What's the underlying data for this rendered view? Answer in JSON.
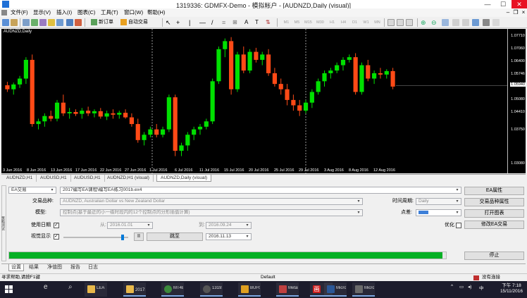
{
  "window": {
    "title": "1319336: GDMFX-Demo - 模拟帐户 - [AUDNZD,Daily (visual)]",
    "min": "—",
    "max": "☐",
    "close": "✕"
  },
  "menu": [
    "文件(F)",
    "显示(V)",
    "插入(I)",
    "图表(C)",
    "工具(T)",
    "窗口(W)",
    "帮助(H)"
  ],
  "toolbar": {
    "new_order": "新订单",
    "autotrade": "自动交易",
    "timeframes": [
      "M1",
      "M5",
      "M15",
      "M30",
      "H1",
      "H4",
      "D1",
      "W1",
      "MN"
    ],
    "font_a": "A",
    "text_t": "T"
  },
  "chart": {
    "symbol": "AUDNZD,Daily",
    "price_labels": [
      "1.07710",
      "1.07060",
      "1.06400",
      "1.05746",
      "1.05080",
      "1.04410",
      "1.03750",
      "1.03080"
    ],
    "current_price": "1.05940",
    "date_labels": [
      "3 Jun 2016",
      "8 Jun 2016",
      "13 Jun 2016",
      "17 Jun 2016",
      "22 Jun 2016",
      "27 Jun 2016",
      "1 Jul 2016",
      "6 Jul 2016",
      "11 Jul 2016",
      "15 Jul 2016",
      "20 Jul 2016",
      "25 Jul 2016",
      "29 Jul 2016",
      "3 Aug 2016",
      "8 Aug 2016",
      "12 Aug 2016"
    ],
    "colors": {
      "bull": "#00e000",
      "bear": "#ff4a16",
      "bg": "#000000"
    }
  },
  "chart_data": {
    "type": "candlestick",
    "symbol": "AUDNZD",
    "timeframe": "Daily",
    "dates": [
      "3 Jun 2016",
      "8 Jun 2016",
      "13 Jun 2016",
      "17 Jun 2016",
      "22 Jun 2016",
      "27 Jun 2016",
      "1 Jul 2016",
      "6 Jul 2016",
      "11 Jul 2016",
      "15 Jul 2016",
      "20 Jul 2016",
      "25 Jul 2016",
      "29 Jul 2016",
      "3 Aug 2016",
      "8 Aug 2016",
      "12 Aug 2016"
    ],
    "ylim": [
      1.03,
      1.079
    ],
    "candles": [
      {
        "o": 1.0595,
        "h": 1.0608,
        "l": 1.057,
        "c": 1.058
      },
      {
        "o": 1.058,
        "h": 1.0605,
        "l": 1.056,
        "c": 1.0598
      },
      {
        "o": 1.0598,
        "h": 1.063,
        "l": 1.0585,
        "c": 1.062
      },
      {
        "o": 1.062,
        "h": 1.07,
        "l": 1.06,
        "c": 1.069
      },
      {
        "o": 1.069,
        "h": 1.071,
        "l": 1.044,
        "c": 1.045
      },
      {
        "o": 1.045,
        "h": 1.047,
        "l": 1.043,
        "c": 1.046
      },
      {
        "o": 1.046,
        "h": 1.049,
        "l": 1.044,
        "c": 1.048
      },
      {
        "o": 1.048,
        "h": 1.05,
        "l": 1.046,
        "c": 1.047
      },
      {
        "o": 1.047,
        "h": 1.054,
        "l": 1.046,
        "c": 1.053
      },
      {
        "o": 1.053,
        "h": 1.056,
        "l": 1.048,
        "c": 1.049
      },
      {
        "o": 1.049,
        "h": 1.051,
        "l": 1.047,
        "c": 1.0495
      },
      {
        "o": 1.0495,
        "h": 1.0505,
        "l": 1.048,
        "c": 1.0488
      },
      {
        "o": 1.0488,
        "h": 1.051,
        "l": 1.047,
        "c": 1.05
      },
      {
        "o": 1.05,
        "h": 1.0515,
        "l": 1.048,
        "c": 1.049
      },
      {
        "o": 1.049,
        "h": 1.0505,
        "l": 1.0475,
        "c": 1.0498
      },
      {
        "o": 1.0498,
        "h": 1.051,
        "l": 1.047,
        "c": 1.0478
      },
      {
        "o": 1.0478,
        "h": 1.05,
        "l": 1.0465,
        "c": 1.049
      },
      {
        "o": 1.049,
        "h": 1.0505,
        "l": 1.047,
        "c": 1.0485
      },
      {
        "o": 1.0485,
        "h": 1.05,
        "l": 1.047,
        "c": 1.0492
      },
      {
        "o": 1.0492,
        "h": 1.0505,
        "l": 1.047,
        "c": 1.0475
      },
      {
        "o": 1.0475,
        "h": 1.049,
        "l": 1.044,
        "c": 1.045
      },
      {
        "o": 1.045,
        "h": 1.047,
        "l": 1.038,
        "c": 1.039
      },
      {
        "o": 1.039,
        "h": 1.042,
        "l": 1.037,
        "c": 1.041
      },
      {
        "o": 1.041,
        "h": 1.044,
        "l": 1.04,
        "c": 1.043
      },
      {
        "o": 1.043,
        "h": 1.045,
        "l": 1.04,
        "c": 1.041
      },
      {
        "o": 1.041,
        "h": 1.044,
        "l": 1.04,
        "c": 1.043
      },
      {
        "o": 1.043,
        "h": 1.056,
        "l": 1.042,
        "c": 1.055
      },
      {
        "o": 1.055,
        "h": 1.056,
        "l": 1.033,
        "c": 1.035
      },
      {
        "o": 1.035,
        "h": 1.038,
        "l": 1.033,
        "c": 1.037
      },
      {
        "o": 1.037,
        "h": 1.042,
        "l": 1.035,
        "c": 1.041
      },
      {
        "o": 1.041,
        "h": 1.044,
        "l": 1.039,
        "c": 1.043
      },
      {
        "o": 1.043,
        "h": 1.045,
        "l": 1.041,
        "c": 1.044
      },
      {
        "o": 1.044,
        "h": 1.047,
        "l": 1.043,
        "c": 1.046
      },
      {
        "o": 1.046,
        "h": 1.062,
        "l": 1.045,
        "c": 1.061
      },
      {
        "o": 1.061,
        "h": 1.074,
        "l": 1.06,
        "c": 1.073
      },
      {
        "o": 1.073,
        "h": 1.077,
        "l": 1.07,
        "c": 1.076
      },
      {
        "o": 1.076,
        "h": 1.0775,
        "l": 1.056,
        "c": 1.058
      },
      {
        "o": 1.058,
        "h": 1.072,
        "l": 1.057,
        "c": 1.071
      },
      {
        "o": 1.071,
        "h": 1.074,
        "l": 1.064,
        "c": 1.065
      },
      {
        "o": 1.065,
        "h": 1.073,
        "l": 1.064,
        "c": 1.072
      },
      {
        "o": 1.072,
        "h": 1.0735,
        "l": 1.068,
        "c": 1.069
      },
      {
        "o": 1.069,
        "h": 1.072,
        "l": 1.067,
        "c": 1.071
      },
      {
        "o": 1.071,
        "h": 1.073,
        "l": 1.063,
        "c": 1.064
      },
      {
        "o": 1.064,
        "h": 1.066,
        "l": 1.059,
        "c": 1.06
      },
      {
        "o": 1.06,
        "h": 1.062,
        "l": 1.056,
        "c": 1.058
      },
      {
        "o": 1.058,
        "h": 1.06,
        "l": 1.052,
        "c": 1.054
      },
      {
        "o": 1.054,
        "h": 1.056,
        "l": 1.05,
        "c": 1.052
      },
      {
        "o": 1.052,
        "h": 1.054,
        "l": 1.048,
        "c": 1.05
      },
      {
        "o": 1.05,
        "h": 1.054,
        "l": 1.049,
        "c": 1.053
      },
      {
        "o": 1.053,
        "h": 1.058,
        "l": 1.051,
        "c": 1.057
      },
      {
        "o": 1.057,
        "h": 1.062,
        "l": 1.056,
        "c": 1.061
      },
      {
        "o": 1.061,
        "h": 1.065,
        "l": 1.059,
        "c": 1.064
      },
      {
        "o": 1.064,
        "h": 1.066,
        "l": 1.062,
        "c": 1.065
      },
      {
        "o": 1.065,
        "h": 1.068,
        "l": 1.064,
        "c": 1.067
      },
      {
        "o": 1.067,
        "h": 1.07,
        "l": 1.065,
        "c": 1.069
      },
      {
        "o": 1.069,
        "h": 1.071,
        "l": 1.068,
        "c": 1.07
      },
      {
        "o": 1.07,
        "h": 1.0715,
        "l": 1.056,
        "c": 1.057
      },
      {
        "o": 1.057,
        "h": 1.068,
        "l": 1.056,
        "c": 1.067
      },
      {
        "o": 1.067,
        "h": 1.069,
        "l": 1.061,
        "c": 1.062
      },
      {
        "o": 1.062,
        "h": 1.065,
        "l": 1.06,
        "c": 1.064
      },
      {
        "o": 1.064,
        "h": 1.066,
        "l": 1.062,
        "c": 1.0635
      },
      {
        "o": 1.0635,
        "h": 1.0655,
        "l": 1.062,
        "c": 1.0648
      },
      {
        "o": 1.0648,
        "h": 1.066,
        "l": 1.058,
        "c": 1.059
      }
    ]
  },
  "chart_tabs": [
    "AUDNZD,H1",
    "AUDUSD,H1",
    "AUDUSD,H1",
    "AUDNZD,H1 (visual)",
    "AUDNZD,Daily (visual)"
  ],
  "tester": {
    "side_label": "策略测试",
    "ea_type": "EA交易",
    "ea_file": "2017编写EA课程\\编写EA练习001b.ex4",
    "symbol_label": "交易品种:",
    "symbol_value": "AUDNZD, Australian Dollar vs New Zealand Dollar",
    "model_label": "模型:",
    "model_value": "控制点(基于最近的小一级时段内的12个控制点的分形插值计算)",
    "use_date_label": "使用日期",
    "from_label": "从:",
    "from_value": "2016.01.01",
    "to_label": "到:",
    "to_value": "2016.09.24",
    "visual_label": "视觉显示",
    "skip_label": "跳至",
    "skip_date": "2016.11.13",
    "pause": "II",
    "period_label": "时间周期:",
    "period_value": "Daily",
    "spread_label": "点差:",
    "optimize_label": "优化",
    "btn_ea_props": "EA属性",
    "btn_symbol_props": "交易品种属性",
    "btn_open_chart": "打开图表",
    "btn_modify_ea": "修改EA交易",
    "btn_stop": "停止",
    "progress": 0.992,
    "slider_level": 0.93
  },
  "bottom_tabs": [
    "设置",
    "结果",
    "净值图",
    "报告",
    "日志"
  ],
  "status": {
    "help": "寻求帮助,请按F1键",
    "profile": "Default",
    "connection": "没有连接"
  },
  "taskbar": {
    "items": [
      "LEA",
      "2017编...",
      "MT4E...",
      "131933...",
      "BUFtp ...",
      "MetaE...",
      "画",
      "Micros...",
      "Micros..."
    ],
    "tray_lang": "中",
    "time": "下午 7:18",
    "date": "15/11/2016"
  }
}
